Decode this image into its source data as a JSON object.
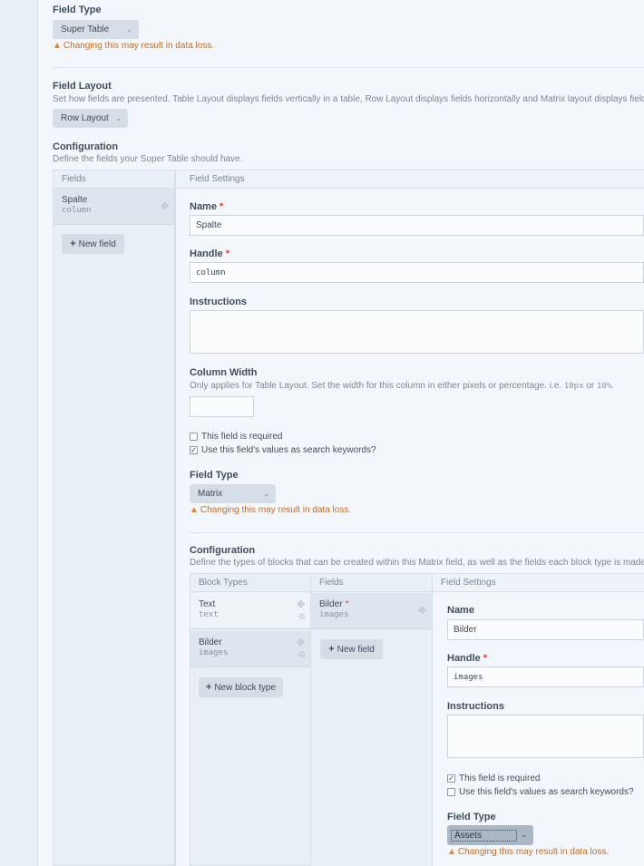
{
  "field_type": {
    "label": "Field Type",
    "value": "Super Table",
    "warning": "Changing this may result in data loss."
  },
  "field_layout": {
    "label": "Field Layout",
    "description": "Set how fields are presented. Table Layout displays fields vertically in a table, Row Layout displays fields horizontally and Matrix layout displays fields like a Mat",
    "value": "Row Layout"
  },
  "configuration": {
    "label": "Configuration",
    "description": "Define the fields your Super Table should have.",
    "fields_header": "Fields",
    "settings_header": "Field Settings",
    "fields": [
      {
        "name": "Spalte",
        "handle": "column"
      }
    ],
    "new_field_label": "New field"
  },
  "settings": {
    "name_label": "Name",
    "name_value": "Spalte",
    "handle_label": "Handle",
    "handle_value": "column",
    "instructions_label": "Instructions",
    "instructions_value": "",
    "column_width_label": "Column Width",
    "column_width_desc_pre": "Only applies for Table Layout. Set the width for this column in either pixels or percentage. i.e.",
    "column_width_ex1": "10px",
    "column_width_or": "or",
    "column_width_ex2": "10%",
    "column_width_end": ".",
    "required_label": "This field is required",
    "required_checked": false,
    "searchable_label": "Use this field's values as search keywords?",
    "searchable_checked": true,
    "type_label": "Field Type",
    "type_value": "Matrix",
    "type_warning": "Changing this may result in data loss."
  },
  "matrix": {
    "label": "Configuration",
    "description": "Define the types of blocks that can be created within this Matrix field, as well as the fields each block type is made up of.",
    "block_types_header": "Block Types",
    "fields_header": "Fields",
    "settings_header": "Field Settings",
    "block_types": [
      {
        "name": "Text",
        "handle": "text"
      },
      {
        "name": "Bilder",
        "handle": "images"
      }
    ],
    "new_block_type_label": "New block type",
    "fields": [
      {
        "name": "Bilder",
        "handle": "images"
      }
    ],
    "new_field_label": "New field",
    "settings": {
      "name_label": "Name",
      "name_value": "Bilder",
      "handle_label": "Handle",
      "handle_value": "images",
      "instructions_label": "Instructions",
      "required_label": "This field is required",
      "required_checked": true,
      "searchable_label": "Use this field's values as search keywords?",
      "searchable_checked": false,
      "type_label": "Field Type",
      "type_value": "Assets",
      "type_warning": "Changing this may result in data loss."
    }
  },
  "icons": {
    "warning": "warning-icon",
    "move": "move-icon",
    "gear": "gear-icon",
    "check": "check-icon",
    "chevron": "chevron-down-icon",
    "plus": "plus-icon"
  },
  "colors": {
    "background": "#f3f7fc",
    "warning": "#c0702a",
    "required": "#e5422b",
    "button": "#d5dde7",
    "selected_item": "#dde5ef"
  }
}
